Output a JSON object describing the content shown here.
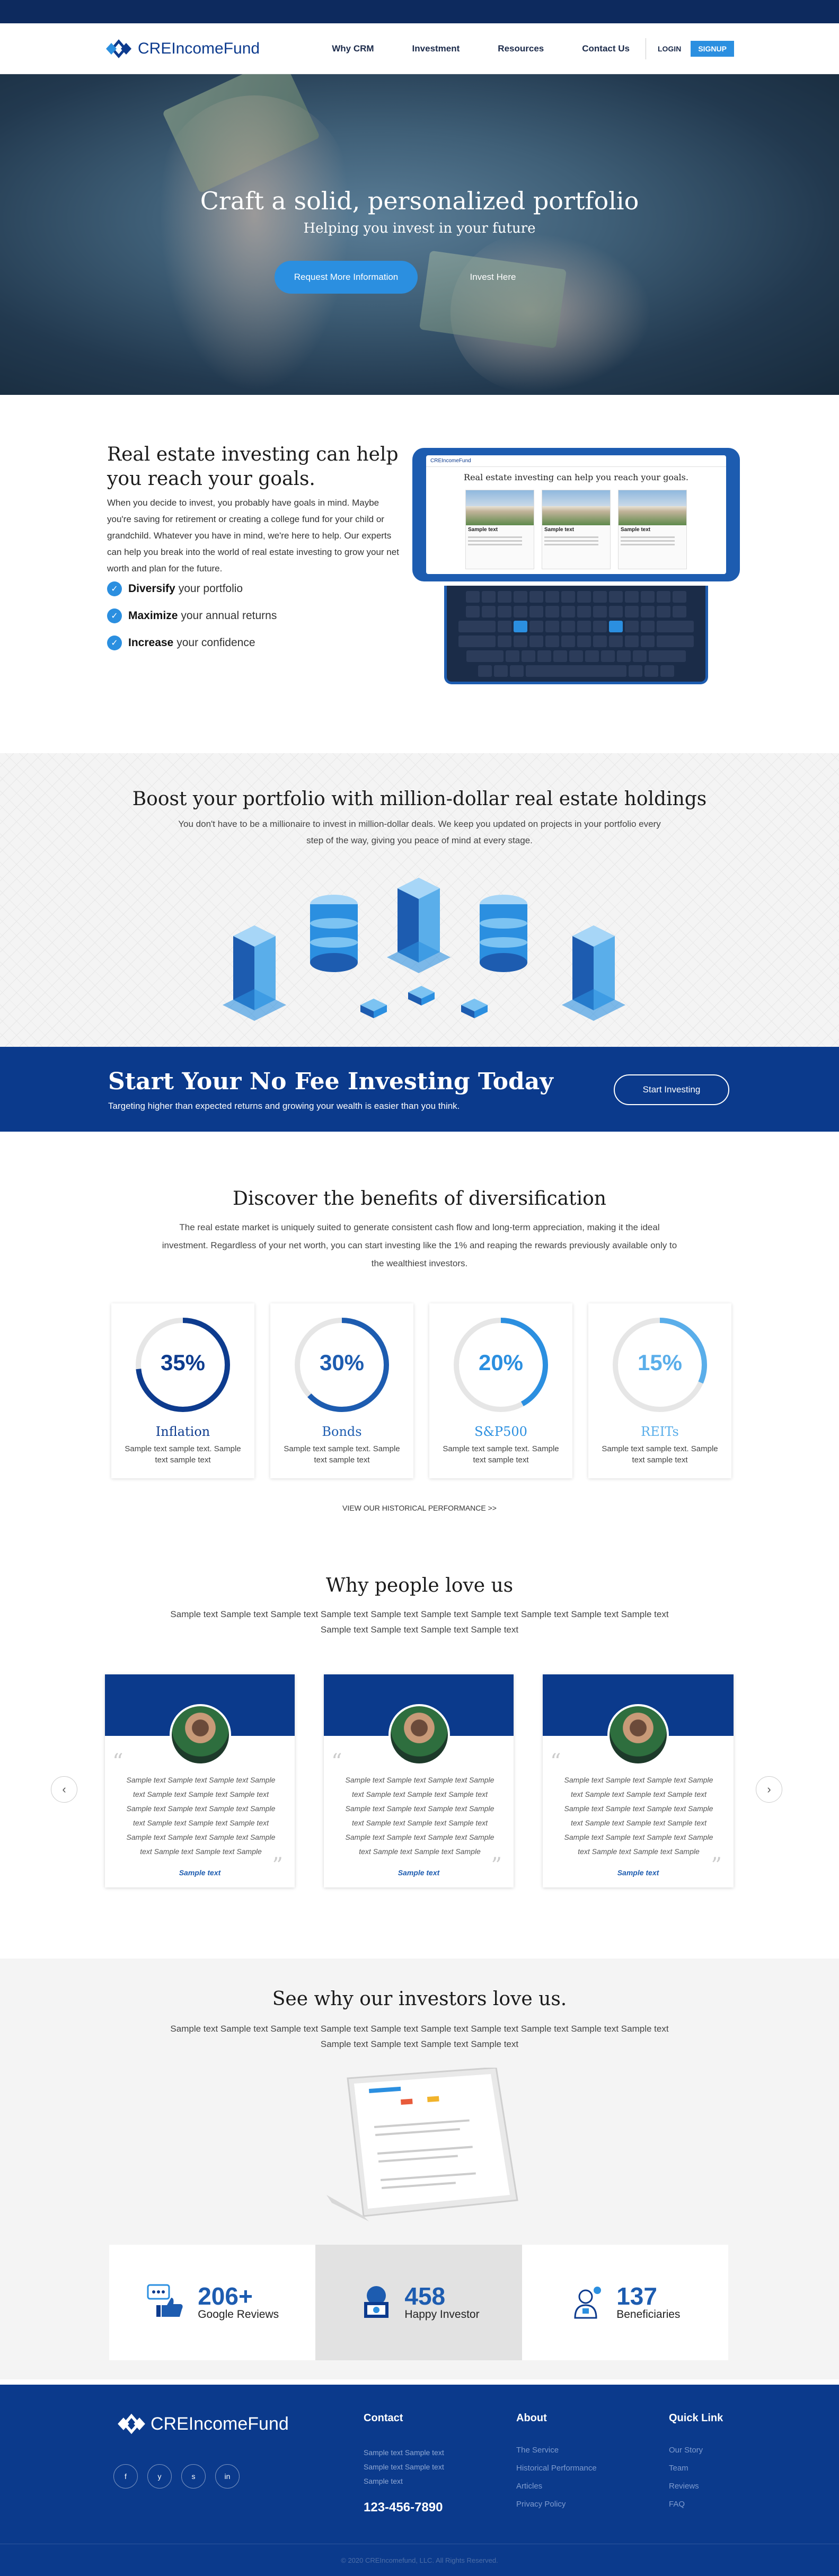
{
  "header": {
    "logo_text": "CREIncomeFund",
    "nav": [
      "Why CRM",
      "Investment",
      "Resources",
      "Contact Us"
    ],
    "login": "LOGIN",
    "signup": "SIGNUP"
  },
  "hero": {
    "title": "Craft a solid, personalized portfolio",
    "subtitle": "Helping you invest in your future",
    "primary_button": "Request More Information",
    "secondary_button": "Invest Here"
  },
  "intro": {
    "title": "Real estate investing can help you reach your goals.",
    "body": "When you decide to invest, you probably have goals in mind. Maybe you're saving for retirement or creating a college fund for your child or grandchild. Whatever you have in mind, we're here to help. Our experts can help you break into the world of real estate investing to grow your net worth and plan for the future.",
    "checks": [
      {
        "bold": "Diversify",
        "rest": "your portfolio"
      },
      {
        "bold": "Maximize",
        "rest": "your annual returns"
      },
      {
        "bold": "Increase",
        "rest": "your confidence"
      }
    ],
    "tablet": {
      "brand": "CREIncomeFund",
      "title": "Real estate investing can help you reach your goals.",
      "card_label": "Sample text"
    }
  },
  "holdings": {
    "title": "Boost your portfolio with million-dollar real estate holdings",
    "body": "You don't have to be a millionaire to invest in million-dollar deals. We keep you updated on projects in your portfolio every step of the way, giving you peace of mind at every stage."
  },
  "cta": {
    "title": "Start Your No Fee Investing Today",
    "subtitle": "Targeting higher than expected returns and growing your wealth is easier than you think.",
    "button": "Start Investing"
  },
  "benefits": {
    "title": "Discover the benefits of diversification",
    "body": "The real estate market is uniquely suited to generate consistent cash flow and long-term appreciation, making it the ideal investment. Regardless of your net worth, you can start investing like the 1% and reaping the rewards previously available only to the wealthiest investors.",
    "cards": [
      {
        "percent": "35%",
        "value": 0.35,
        "name": "Inflation",
        "desc": "Sample text sample text. Sample text sample text",
        "color": "#0d3b8e"
      },
      {
        "percent": "30%",
        "value": 0.3,
        "name": "Bonds",
        "desc": "Sample text sample text. Sample text sample text",
        "color": "#1d5cb0"
      },
      {
        "percent": "20%",
        "value": 0.2,
        "name": "S&P500",
        "desc": "Sample text sample text. Sample text sample text",
        "color": "#2b8fe0"
      },
      {
        "percent": "15%",
        "value": 0.15,
        "name": "REITs",
        "desc": "Sample text sample text. Sample text sample text",
        "color": "#5aaeea"
      }
    ],
    "history_link": "VIEW OUR HISTORICAL PERFORMANCE >>"
  },
  "testimonials": {
    "title": "Why people love us",
    "body": "Sample text Sample text Sample text Sample text Sample text Sample text Sample text Sample text Sample text Sample text Sample text Sample text Sample text Sample text",
    "items": [
      {
        "text": "Sample text Sample text Sample text Sample text Sample text Sample text Sample text Sample text Sample text Sample text Sample text Sample text Sample text Sample text Sample text Sample text Sample text Sample text Sample text Sample text Sample",
        "author": "Sample text"
      },
      {
        "text": "Sample text Sample text Sample text Sample text Sample text Sample text Sample text Sample text Sample text Sample text Sample text Sample text Sample text Sample text Sample text Sample text Sample text Sample text Sample text Sample text Sample",
        "author": "Sample text"
      },
      {
        "text": "Sample text Sample text Sample text Sample text Sample text Sample text Sample text Sample text Sample text Sample text Sample text Sample text Sample text Sample text Sample text Sample text Sample text Sample text Sample text Sample text Sample",
        "author": "Sample text"
      }
    ]
  },
  "investors": {
    "title": "See why our investors love us.",
    "body": "Sample text Sample text Sample text Sample text Sample text Sample text Sample text Sample text Sample text Sample text Sample text Sample text Sample text Sample text",
    "stats": [
      {
        "number": "206+",
        "label": "Google Reviews",
        "icon": "thumbs-up-chat-icon"
      },
      {
        "number": "458",
        "label": "Happy Investor",
        "icon": "investor-money-icon"
      },
      {
        "number": "137",
        "label": "Beneficiaries",
        "icon": "beneficiary-person-icon"
      }
    ]
  },
  "footer": {
    "logo_text": "CREIncomeFund",
    "social": [
      "f",
      "y",
      "s",
      "in"
    ],
    "contact_title": "Contact",
    "contact_lines": [
      "Sample text Sample text",
      "Sample text Sample text",
      "Sample text"
    ],
    "phone": "123-456-7890",
    "about_title": "About",
    "about_links": [
      "The Service",
      "Historical Performance",
      "Articles",
      "Privacy Policy"
    ],
    "quick_title": "Quick Link",
    "quick_links": [
      "Our Story",
      "Team",
      "Reviews",
      "FAQ"
    ],
    "copyright": "© 2020 CREIncomefund, LLC. All Rights Reserved."
  },
  "colors": {
    "brand": "#0b3a8c",
    "accent": "#2b8fe0"
  }
}
